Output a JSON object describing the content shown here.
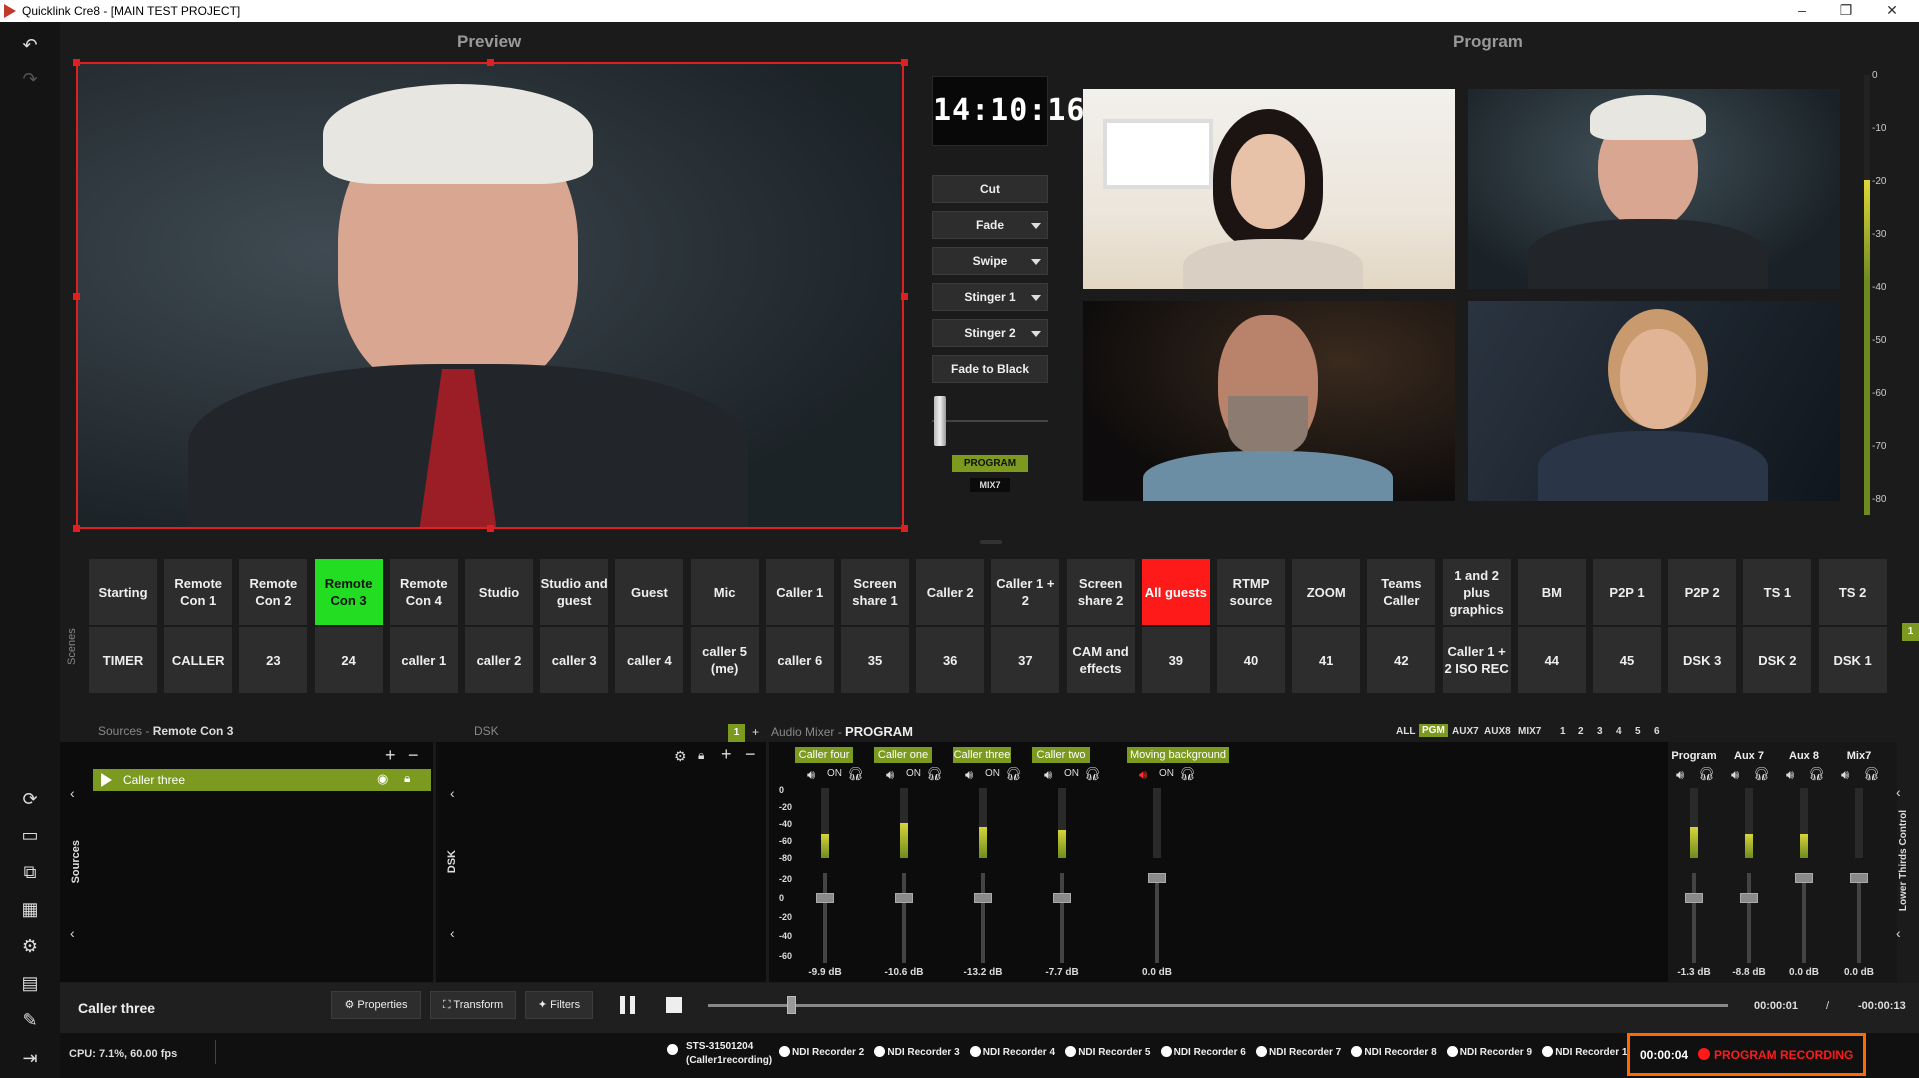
{
  "window": {
    "title": "Quicklink Cre8 - [MAIN TEST PROJECT]",
    "minimize": "–",
    "maximize": "❐",
    "close": "✕"
  },
  "preview": {
    "title": "Preview"
  },
  "program": {
    "title": "Program"
  },
  "clock": "14:10:16",
  "transitions": {
    "cut": "Cut",
    "fade": "Fade",
    "swipe": "Swipe",
    "stinger1": "Stinger 1",
    "stinger2": "Stinger 2",
    "fade_black": "Fade to Black"
  },
  "badges": {
    "program": "PROGRAM",
    "mix": "MIX7"
  },
  "vu_labels": [
    "0",
    "-10",
    "-20",
    "-30",
    "-40",
    "-50",
    "-60",
    "-70",
    "-80"
  ],
  "scenes_label": "Scenes",
  "scenes_row1": [
    "Starting",
    "Remote Con 1",
    "Remote Con 2",
    "Remote Con 3",
    "Remote Con 4",
    "Studio",
    "Studio and guest",
    "Guest",
    "Mic",
    "Caller 1",
    "Screen share 1",
    "Caller 2",
    "Caller 1 + 2",
    "Screen share 2",
    "All guests",
    "RTMP source",
    "ZOOM",
    "Teams Caller",
    "1 and 2 plus graphics",
    "BM",
    "P2P 1",
    "P2P 2",
    "TS 1",
    "TS 2"
  ],
  "scenes_row2": [
    "TIMER",
    "CALLER",
    "23",
    "24",
    "caller 1",
    "caller 2",
    "caller 3",
    "caller 4",
    "caller 5 (me)",
    "caller 6",
    "35",
    "36",
    "37",
    "CAM and effects",
    "39",
    "40",
    "41",
    "42",
    "Caller 1 + 2 ISO REC",
    "44",
    "45",
    "DSK 3",
    "DSK 2",
    "DSK 1"
  ],
  "scene_page": "1",
  "sources": {
    "header": "Sources",
    "scene": "Remote Con 3",
    "item": "Caller three",
    "side_label": "Sources"
  },
  "dsk": {
    "header": "DSK",
    "side_label": "DSK",
    "page": "1"
  },
  "mixer": {
    "header": "Audio Mixer",
    "target": "PROGRAM",
    "filters": [
      "ALL",
      "PGM",
      "AUX7",
      "AUX8",
      "MIX7",
      "1",
      "2",
      "3",
      "4",
      "5",
      "6"
    ],
    "scale": [
      "0",
      "-20",
      "-40",
      "-60",
      "-80",
      "-20",
      "0",
      "-20",
      "-40",
      "-60"
    ],
    "channels": [
      {
        "name": "Caller four",
        "on": "ON",
        "db": "-9.9 dB",
        "level": 0.35
      },
      {
        "name": "Caller one",
        "on": "ON",
        "db": "-10.6 dB",
        "level": 0.5
      },
      {
        "name": "Caller three",
        "on": "ON",
        "db": "-13.2 dB",
        "level": 0.45
      },
      {
        "name": "Caller two",
        "on": "ON",
        "db": "-7.7 dB",
        "level": 0.4
      },
      {
        "name": "Moving background",
        "on": "ON",
        "db": "0.0 dB",
        "level": 0
      }
    ],
    "buses": [
      {
        "name": "Program",
        "db": "-1.3 dB",
        "level": 0.45
      },
      {
        "name": "Aux 7",
        "db": "-8.8 dB",
        "level": 0.35
      },
      {
        "name": "Aux 8",
        "db": "0.0 dB",
        "level": 0.35
      },
      {
        "name": "Mix7",
        "db": "0.0 dB",
        "level": 0
      }
    ]
  },
  "lower_thirds": "Lower Thirds Control",
  "bottom": {
    "selected": "Caller three",
    "properties": "Properties",
    "transform": "Transform",
    "filters": "Filters",
    "time_pos": "00:00:01",
    "sep": "/",
    "time_total": "-00:00:13"
  },
  "status": {
    "cpu": "CPU: 7.1%, 60.00 fps",
    "sts": "STS-31501204",
    "sts_sub": "(Caller1recording)",
    "recorders": [
      "NDI Recorder 2",
      "NDI Recorder 3",
      "NDI Recorder 4",
      "NDI Recorder 5",
      "NDI Recorder 6",
      "NDI Recorder 7",
      "NDI Recorder 8",
      "NDI Recorder 9",
      "NDI Recorder 1"
    ],
    "rec_time": "00:00:04",
    "rec_label": "PROGRAM RECORDING"
  },
  "colors": {
    "accent_green": "#7c9a1f",
    "active_scene": "#22dd22",
    "alert_scene": "#ff1a1a",
    "recording": "#ff1a1a",
    "recording_border": "#ff6a00"
  },
  "icons": [
    "undo-icon",
    "redo-icon",
    "refresh-icon",
    "monitor-icon",
    "display-settings-icon",
    "grid-icon",
    "gear-icon",
    "folder-icon",
    "tools-icon",
    "exit-icon",
    "eye-icon",
    "lock-icon",
    "speaker-icon",
    "headphones-icon",
    "play-icon",
    "pause-icon",
    "stop-icon"
  ]
}
